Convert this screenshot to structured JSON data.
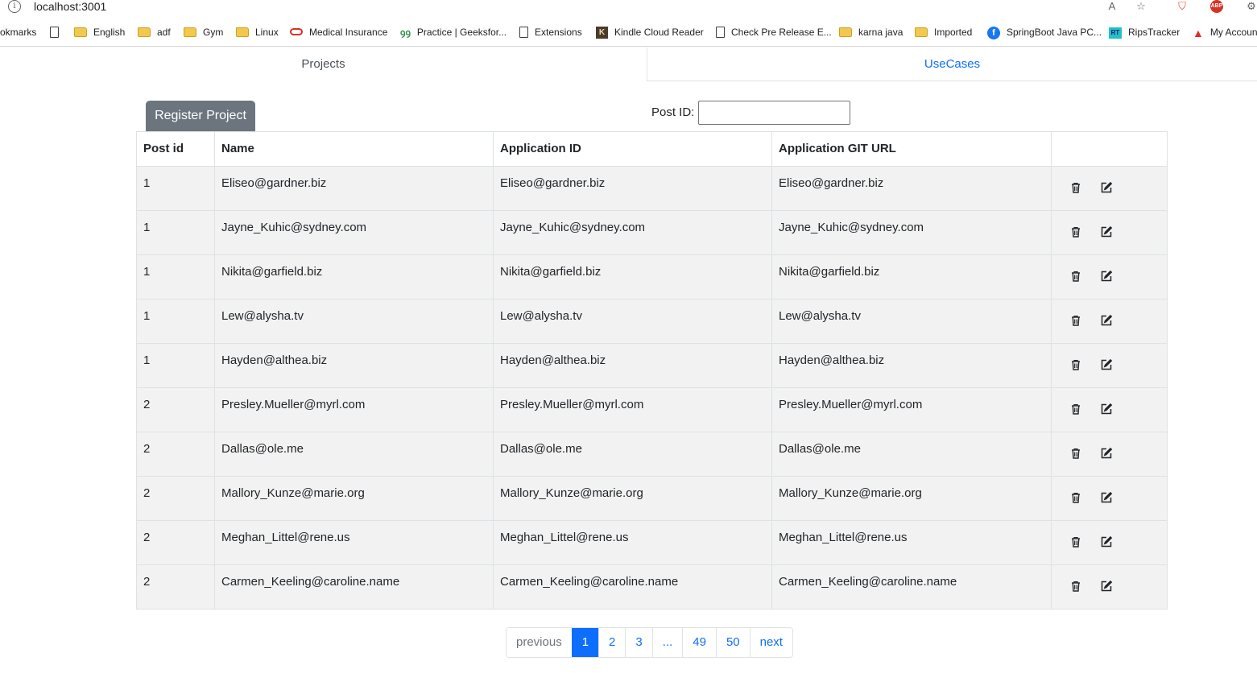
{
  "browser": {
    "url": "localhost:3001",
    "icons": [
      "info-icon",
      "read-aloud-icon",
      "favorite-star-icon",
      "shield-icon",
      "abp-icon",
      "settings-gear-icon"
    ],
    "abp_label": "ABP"
  },
  "bookmarks": [
    {
      "label": "okmarks",
      "icon": "none"
    },
    {
      "label": "",
      "icon": "page"
    },
    {
      "label": "English",
      "icon": "folder"
    },
    {
      "label": "adf",
      "icon": "folder"
    },
    {
      "label": "Gym",
      "icon": "folder"
    },
    {
      "label": "Linux",
      "icon": "folder"
    },
    {
      "label": "Medical Insurance",
      "icon": "oval"
    },
    {
      "label": "Practice | Geeksfor...",
      "icon": "gfg"
    },
    {
      "label": "Extensions",
      "icon": "page"
    },
    {
      "label": "Kindle Cloud Reader",
      "icon": "kindle"
    },
    {
      "label": "Check Pre Release E...",
      "icon": "page"
    },
    {
      "label": "karna java",
      "icon": "folder"
    },
    {
      "label": "Imported",
      "icon": "folder"
    },
    {
      "label": "SpringBoot Java PC...",
      "icon": "facebook"
    },
    {
      "label": "RipsTracker",
      "icon": "rips"
    },
    {
      "label": "My Accoun",
      "icon": "account"
    }
  ],
  "tabs": {
    "projects": "Projects",
    "usecases": "UseCases"
  },
  "toolbar": {
    "register_label": "Register Project",
    "postid_label": "Post ID:",
    "postid_value": ""
  },
  "table": {
    "headers": [
      "Post id",
      "Name",
      "Application ID",
      "Application GIT URL",
      ""
    ],
    "rows": [
      {
        "post_id": "1",
        "name": "Eliseo@gardner.biz",
        "app_id": "Eliseo@gardner.biz",
        "git_url": "Eliseo@gardner.biz"
      },
      {
        "post_id": "1",
        "name": "Jayne_Kuhic@sydney.com",
        "app_id": "Jayne_Kuhic@sydney.com",
        "git_url": "Jayne_Kuhic@sydney.com"
      },
      {
        "post_id": "1",
        "name": "Nikita@garfield.biz",
        "app_id": "Nikita@garfield.biz",
        "git_url": "Nikita@garfield.biz"
      },
      {
        "post_id": "1",
        "name": "Lew@alysha.tv",
        "app_id": "Lew@alysha.tv",
        "git_url": "Lew@alysha.tv"
      },
      {
        "post_id": "1",
        "name": "Hayden@althea.biz",
        "app_id": "Hayden@althea.biz",
        "git_url": "Hayden@althea.biz"
      },
      {
        "post_id": "2",
        "name": "Presley.Mueller@myrl.com",
        "app_id": "Presley.Mueller@myrl.com",
        "git_url": "Presley.Mueller@myrl.com"
      },
      {
        "post_id": "2",
        "name": "Dallas@ole.me",
        "app_id": "Dallas@ole.me",
        "git_url": "Dallas@ole.me"
      },
      {
        "post_id": "2",
        "name": "Mallory_Kunze@marie.org",
        "app_id": "Mallory_Kunze@marie.org",
        "git_url": "Mallory_Kunze@marie.org"
      },
      {
        "post_id": "2",
        "name": "Meghan_Littel@rene.us",
        "app_id": "Meghan_Littel@rene.us",
        "git_url": "Meghan_Littel@rene.us"
      },
      {
        "post_id": "2",
        "name": "Carmen_Keeling@caroline.name",
        "app_id": "Carmen_Keeling@caroline.name",
        "git_url": "Carmen_Keeling@caroline.name"
      }
    ],
    "row_actions": [
      "trash-icon",
      "edit-icon"
    ]
  },
  "pagination": {
    "previous": "previous",
    "pages": [
      "1",
      "2",
      "3",
      "...",
      "49",
      "50"
    ],
    "active_page": "1",
    "next": "next"
  },
  "colors": {
    "accent": "#0d6efd",
    "register_button": "#6c757d",
    "row_background": "#f2f2f2"
  }
}
